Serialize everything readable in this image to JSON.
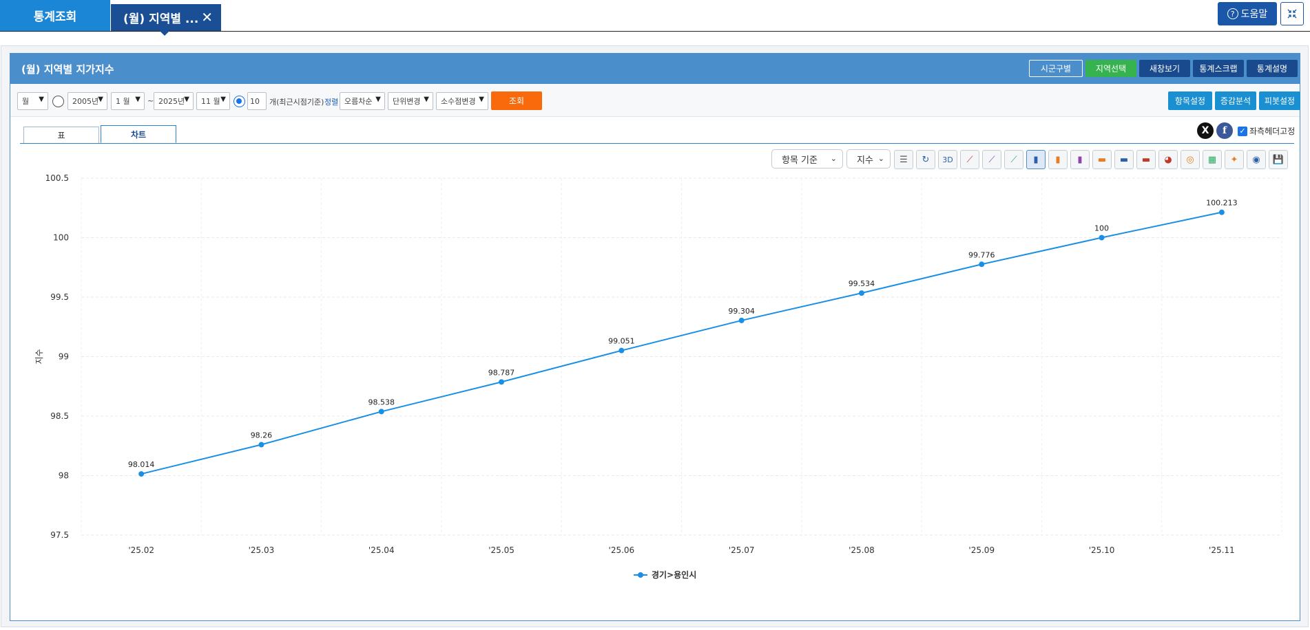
{
  "top_tabs": {
    "main_label": "통계조회",
    "active_label": "(월) 지역별 ...",
    "close_glyph": "✕"
  },
  "help_label": "도움말",
  "panel": {
    "title": "(월) 지역별 지가지수",
    "header_buttons": [
      "시군구별",
      "지역선택",
      "새창보기",
      "통계스크랩",
      "통계설명"
    ]
  },
  "filter": {
    "period_type": "월",
    "start_year": "2005년",
    "start_month": "1 월",
    "range_sep": "~",
    "end_year": "2025년",
    "end_month": "11 월",
    "recent_count": "10",
    "recent_label": "개(최근시점기준)",
    "sort_label": "정렬",
    "sort_value": "오름차순",
    "unit_change": "단위변경",
    "decimal_change": "소수점변경",
    "search_label": "조회",
    "right_buttons": [
      "항목설정",
      "증감분석",
      "피봇설정"
    ]
  },
  "sub_tabs": [
    "표",
    "차트"
  ],
  "fix_header_label": "좌측헤더고정",
  "chart_toolbar": {
    "basis_select": "항목 기준",
    "value_select": "지수",
    "threed_label": "3D"
  },
  "colors": {
    "series": "#1a8fe3",
    "header": "#4b8ecc",
    "search": "#f96a0c"
  },
  "chart_data": {
    "type": "line",
    "categories": [
      "'25.02",
      "'25.03",
      "'25.04",
      "'25.05",
      "'25.06",
      "'25.07",
      "'25.08",
      "'25.09",
      "'25.10",
      "'25.11"
    ],
    "series": [
      {
        "name": "경기>용인시",
        "values": [
          98.014,
          98.26,
          98.538,
          98.787,
          99.051,
          99.304,
          99.534,
          99.776,
          100,
          100.213
        ]
      }
    ],
    "value_labels": [
      "98.014",
      "98.26",
      "98.538",
      "98.787",
      "99.051",
      "99.304",
      "99.534",
      "99.776",
      "100",
      "100.213"
    ],
    "ylabel": "지수",
    "ylim": [
      97.5,
      100.5
    ],
    "yticks": [
      "97.5",
      "98",
      "98.5",
      "99",
      "99.5",
      "100",
      "100.5"
    ],
    "grid": true,
    "legend": "bottom"
  }
}
